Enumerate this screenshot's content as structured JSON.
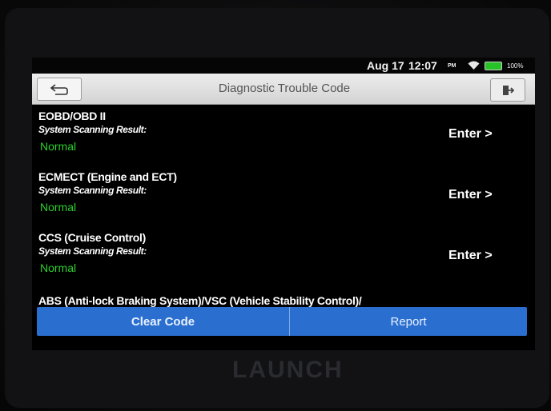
{
  "status_bar": {
    "date": "Aug 17",
    "time": "12:07",
    "ampm": "PM",
    "battery": "100%"
  },
  "header": {
    "title": "Diagnostic Trouble Code"
  },
  "systems": [
    {
      "name": "EOBD/OBD II",
      "subtitle": "System Scanning Result:",
      "status": "Normal",
      "action": "Enter >"
    },
    {
      "name": "ECMECT (Engine and ECT)",
      "subtitle": "System Scanning Result:",
      "status": "Normal",
      "action": "Enter >"
    },
    {
      "name": "CCS (Cruise Control)",
      "subtitle": "System Scanning Result:",
      "status": "Normal",
      "action": "Enter >"
    },
    {
      "name": "ABS (Anti-lock Braking System)/VSC (Vehicle Stability Control)/"
    }
  ],
  "footer": {
    "clear_code_label": "Clear Code",
    "report_label": "Report"
  },
  "device": {
    "brand": "LAUNCH"
  },
  "colors": {
    "normal_status": "#2bd12b",
    "button_bar": "#2a6fd0",
    "battery": "#27c227"
  }
}
